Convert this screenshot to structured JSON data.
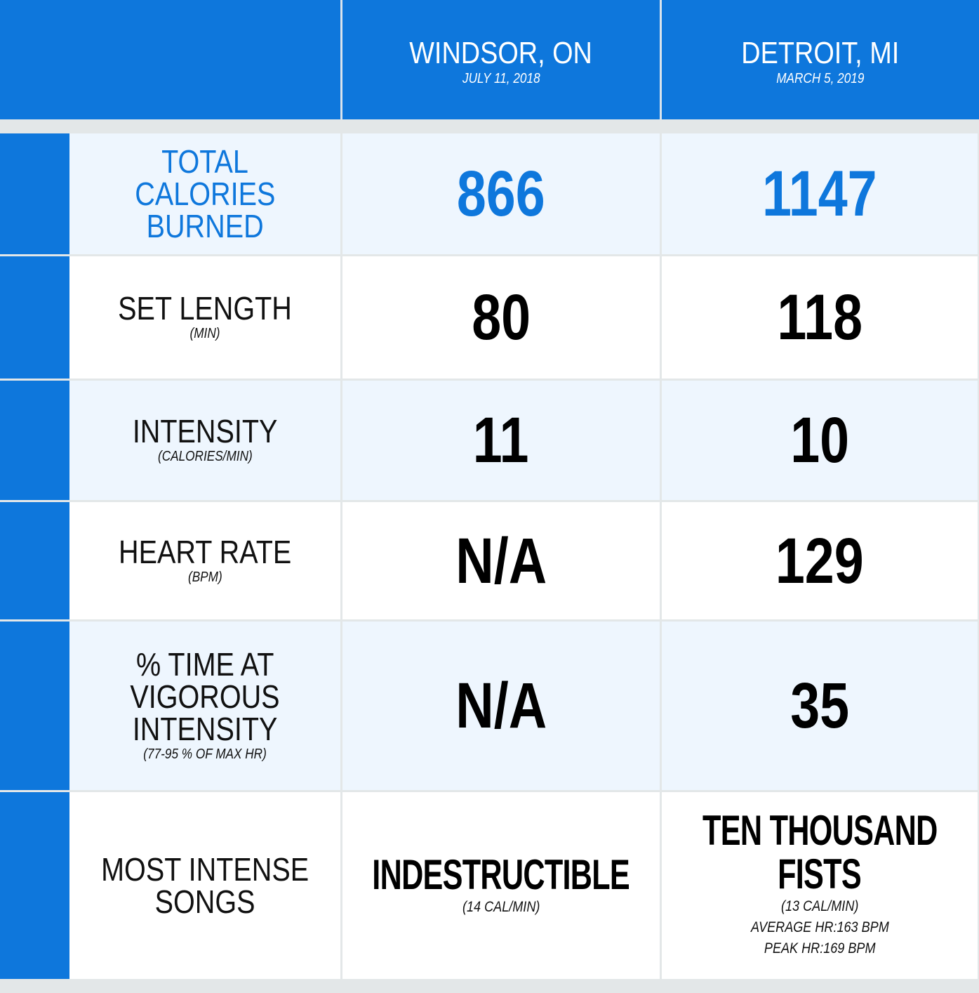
{
  "header": {
    "columns": [
      {
        "city": "WINDSOR, ON",
        "date": "JULY 11, 2018"
      },
      {
        "city": "DETROIT, MI",
        "date": "MARCH 5, 2019"
      }
    ]
  },
  "rows": [
    {
      "label_lines": [
        "TOTAL",
        "CALORIES",
        "BURNED"
      ],
      "sub": "",
      "values": [
        "866",
        "1147"
      ]
    },
    {
      "label_lines": [
        "SET LENGTH"
      ],
      "sub": "(MIN)",
      "values": [
        "80",
        "118"
      ]
    },
    {
      "label_lines": [
        "INTENSITY"
      ],
      "sub": "(CALORIES/MIN)",
      "values": [
        "11",
        "10"
      ]
    },
    {
      "label_lines": [
        "HEART RATE"
      ],
      "sub": "(BPM)",
      "values": [
        "N/A",
        "129"
      ]
    },
    {
      "label_lines": [
        "% TIME AT",
        "VIGOROUS",
        "INTENSITY"
      ],
      "sub": "(77-95 % OF MAX HR)",
      "values": [
        "N/A",
        "35"
      ]
    },
    {
      "label_lines": [
        "MOST INTENSE",
        "SONGS"
      ],
      "sub": ""
    }
  ],
  "songs": {
    "windsor": {
      "title_lines": [
        "INDESTRUCTIBLE"
      ],
      "details": [
        "(14 CAL/MIN)"
      ]
    },
    "detroit": {
      "title_lines": [
        "TEN THOUSAND",
        "FISTS"
      ],
      "details": [
        "(13 CAL/MIN)",
        "AVERAGE HR:163 BPM",
        "PEAK HR:169 BPM"
      ]
    }
  },
  "colors": {
    "accent": "#0e77dc",
    "row_alt": "#eef6fe",
    "background": "#e3e7e8"
  }
}
